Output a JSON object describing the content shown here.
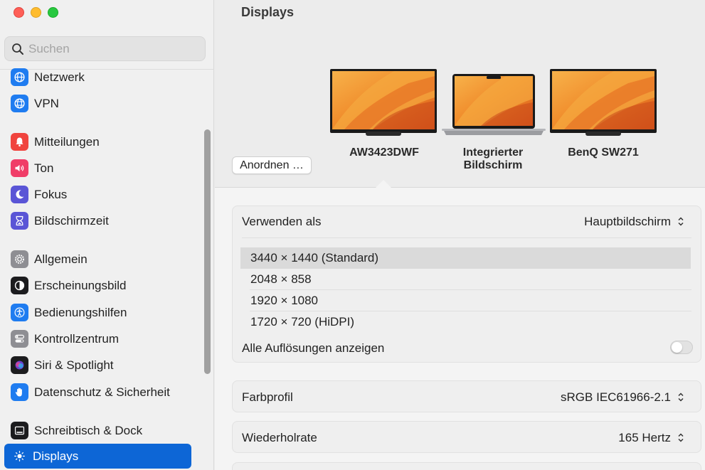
{
  "window": {
    "title": "Displays"
  },
  "search": {
    "placeholder": "Suchen",
    "icon": "magnifier-icon"
  },
  "sidebar": {
    "items": [
      {
        "label": "Netzwerk",
        "icon": "globe-icon",
        "color": "#1f7cf0"
      },
      {
        "label": "VPN",
        "icon": "vpn-globe-icon",
        "color": "#1f7cf0"
      },
      {
        "label": "Mitteilungen",
        "icon": "bell-icon",
        "color": "#f0443e"
      },
      {
        "label": "Ton",
        "icon": "speaker-icon",
        "color": "#f03d68"
      },
      {
        "label": "Fokus",
        "icon": "moon-icon",
        "color": "#5a55d6"
      },
      {
        "label": "Bildschirmzeit",
        "icon": "hourglass-icon",
        "color": "#5a55d6"
      },
      {
        "label": "Allgemein",
        "icon": "gear-icon",
        "color": "#8e8e93"
      },
      {
        "label": "Erscheinungsbild",
        "icon": "appearance-icon",
        "color": "#1c1c1e"
      },
      {
        "label": "Bedienungshilfen",
        "icon": "accessibility-icon",
        "color": "#1f7cf0"
      },
      {
        "label": "Kontrollzentrum",
        "icon": "toggles-icon",
        "color": "#8e8e93"
      },
      {
        "label": "Siri & Spotlight",
        "icon": "siri-icon",
        "color": "#6b3fcf"
      },
      {
        "label": "Datenschutz & Sicherheit",
        "icon": "hand-icon",
        "color": "#1f7cf0"
      },
      {
        "label": "Schreibtisch & Dock",
        "icon": "dock-icon",
        "color": "#1c1c1e"
      },
      {
        "label": "Displays",
        "icon": "sun-icon",
        "color": "#0d66d6",
        "selected": true
      }
    ]
  },
  "arrange": {
    "button_label": "Anordnen …"
  },
  "displays": [
    {
      "name": "AW3423DWF",
      "selected": true
    },
    {
      "name": "Integrierter Bildschirm"
    },
    {
      "name": "BenQ SW271"
    }
  ],
  "settings": {
    "use_as": {
      "label": "Verwenden als",
      "value": "Hauptbildschirm"
    },
    "resolutions": [
      {
        "label": "3440 × 1440 (Standard)",
        "selected": true
      },
      {
        "label": "2048 × 858"
      },
      {
        "label": "1920 × 1080"
      },
      {
        "label": "1720 × 720 (HiDPI)"
      }
    ],
    "show_all": {
      "label": "Alle Auflösungen anzeigen",
      "enabled": false
    },
    "color_profile": {
      "label": "Farbprofil",
      "value": "sRGB IEC61966-2.1"
    },
    "refresh_rate": {
      "label": "Wiederholrate",
      "value": "165 Hertz"
    }
  },
  "colors": {
    "accent": "#0d66d6",
    "wallpaper_orange": "#f39a2a"
  }
}
